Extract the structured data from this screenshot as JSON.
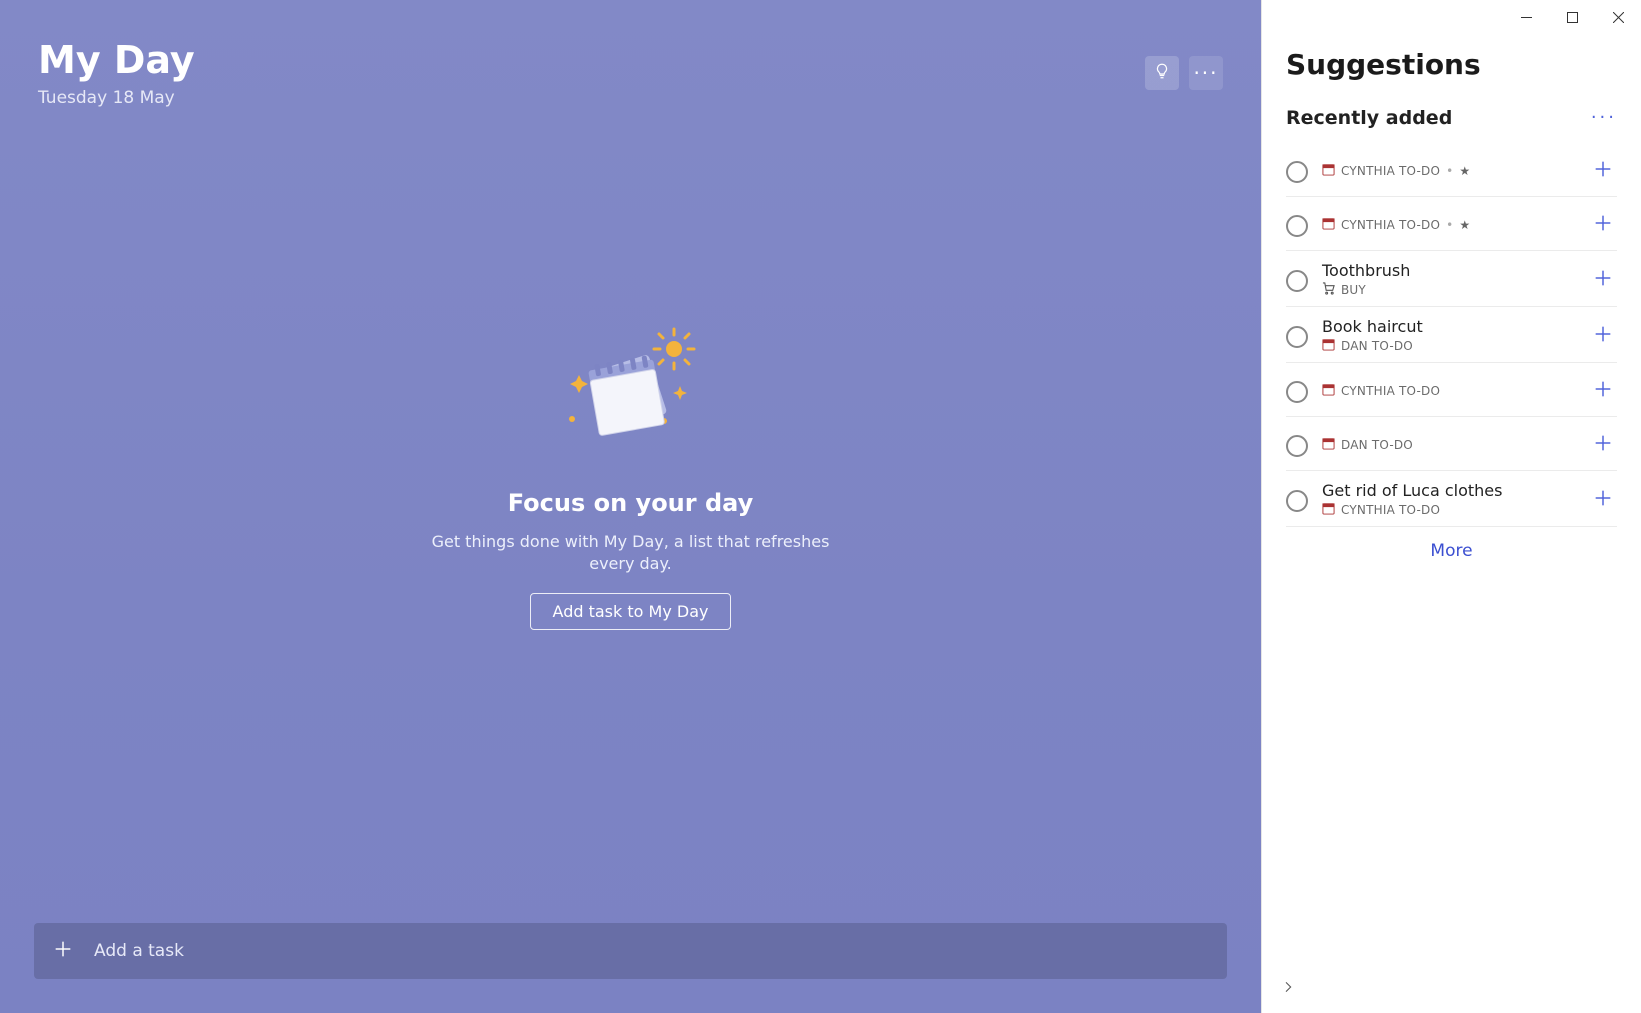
{
  "header": {
    "title": "My Day",
    "date": "Tuesday 18 May"
  },
  "empty": {
    "title": "Focus on your day",
    "desc": "Get things done with My Day, a list that refreshes every day.",
    "button": "Add task to My Day"
  },
  "addbar": {
    "placeholder": "Add a task"
  },
  "suggestions": {
    "title": "Suggestions",
    "section": "Recently added",
    "more": "More",
    "items": [
      {
        "title": "",
        "list": "CYNTHIA TO-DO",
        "icon": "calendar",
        "starred": true
      },
      {
        "title": "",
        "list": "CYNTHIA TO-DO",
        "icon": "calendar",
        "starred": true
      },
      {
        "title": "Toothbrush",
        "list": "BUY",
        "icon": "cart",
        "starred": false
      },
      {
        "title": "Book haircut",
        "list": "DAN TO-DO",
        "icon": "calendar",
        "starred": false
      },
      {
        "title": "",
        "list": "CYNTHIA TO-DO",
        "icon": "calendar",
        "starred": false
      },
      {
        "title": "",
        "list": "DAN TO-DO",
        "icon": "calendar",
        "starred": false
      },
      {
        "title": "Get rid of Luca clothes",
        "list": "CYNTHIA TO-DO",
        "icon": "calendar",
        "starred": false
      }
    ]
  }
}
